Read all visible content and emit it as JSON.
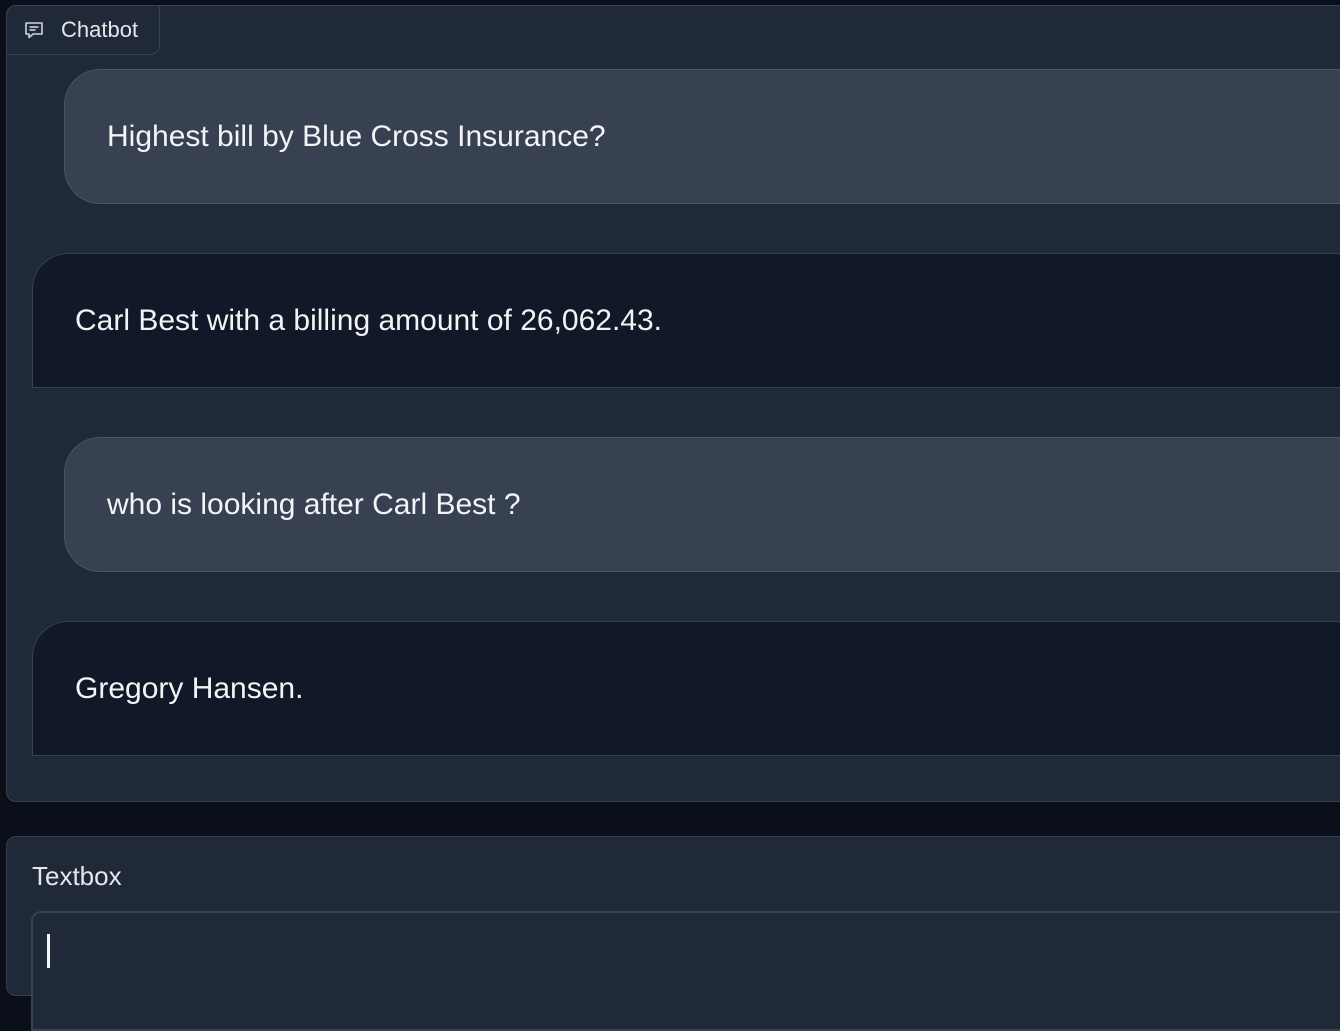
{
  "chatbot": {
    "label": "Chatbot",
    "icon": "chat-icon",
    "messages": [
      {
        "role": "user",
        "text": "Highest bill by Blue Cross Insurance?"
      },
      {
        "role": "bot",
        "text": "Carl Best with a billing amount of 26,062.43."
      },
      {
        "role": "user",
        "text": "who is looking after Carl Best ?"
      },
      {
        "role": "bot",
        "text": "Gregory Hansen."
      }
    ]
  },
  "textbox": {
    "label": "Textbox",
    "value": "",
    "placeholder": ""
  },
  "colors": {
    "page_bg": "#0b0f19",
    "panel_bg": "#1f2937",
    "user_bubble": "#374151",
    "bot_bubble": "#111827",
    "border": "#374151"
  }
}
